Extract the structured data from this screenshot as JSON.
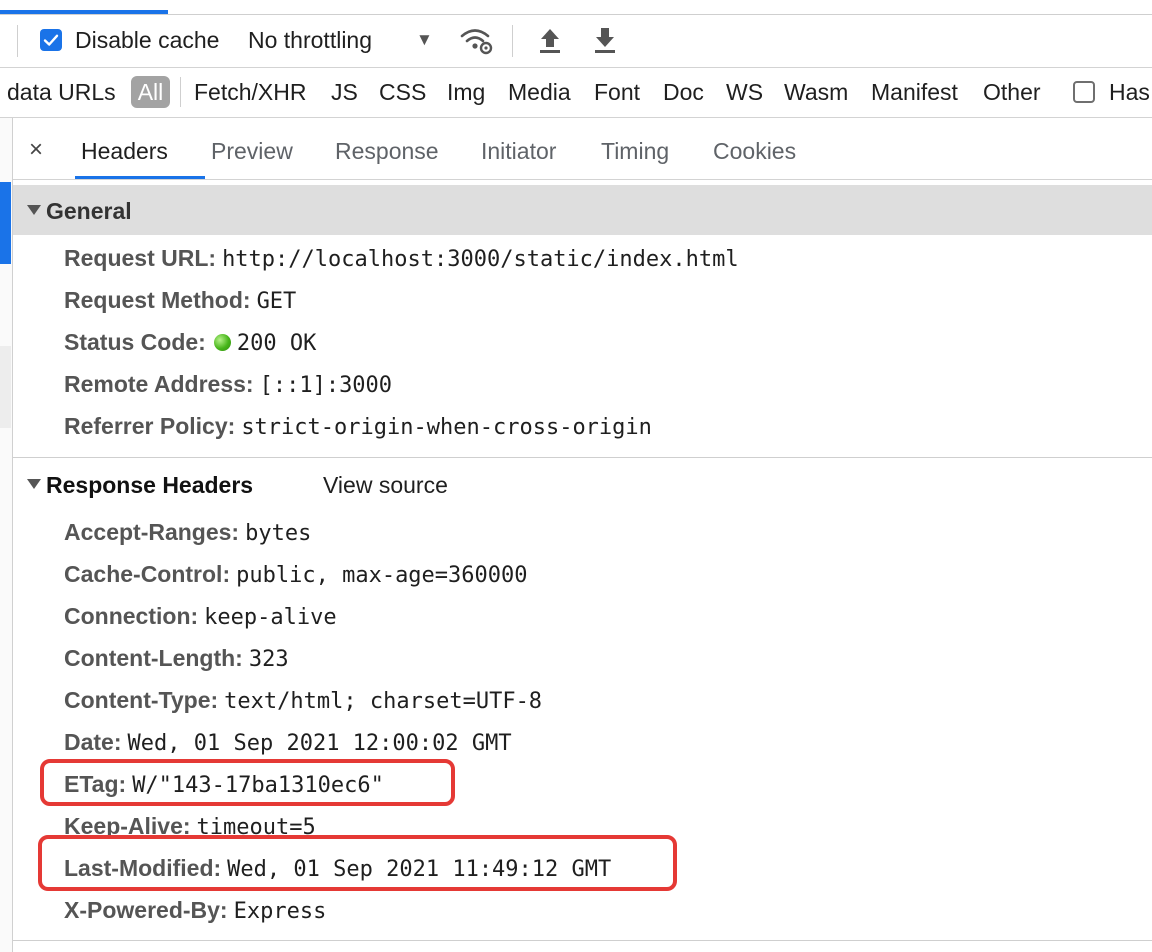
{
  "toolbar": {
    "disable_cache_label": "Disable cache",
    "disable_cache_checked": true,
    "throttling_value": "No throttling",
    "throttling_arrow": "▼"
  },
  "filters": {
    "items": [
      "data URLs",
      "All",
      "Fetch/XHR",
      "JS",
      "CSS",
      "Img",
      "Media",
      "Font",
      "Doc",
      "WS",
      "Wasm",
      "Manifest",
      "Other"
    ],
    "trailing_checkbox_label": "Has"
  },
  "tabs": {
    "close": "×",
    "items": [
      "Headers",
      "Preview",
      "Response",
      "Initiator",
      "Timing",
      "Cookies"
    ],
    "active": "Headers"
  },
  "general": {
    "title": "General",
    "rows": [
      {
        "key": "Request URL:",
        "value": "http://localhost:3000/static/index.html"
      },
      {
        "key": "Request Method:",
        "value": "GET"
      },
      {
        "key": "Status Code:",
        "value": "200 OK"
      },
      {
        "key": "Remote Address:",
        "value": "[::1]:3000"
      },
      {
        "key": "Referrer Policy:",
        "value": "strict-origin-when-cross-origin"
      }
    ]
  },
  "response_headers": {
    "title": "Response Headers",
    "view_source": "View source",
    "rows": [
      {
        "key": "Accept-Ranges:",
        "value": "bytes"
      },
      {
        "key": "Cache-Control:",
        "value": "public, max-age=360000"
      },
      {
        "key": "Connection:",
        "value": "keep-alive"
      },
      {
        "key": "Content-Length:",
        "value": "323"
      },
      {
        "key": "Content-Type:",
        "value": "text/html; charset=UTF-8"
      },
      {
        "key": "Date:",
        "value": "Wed, 01 Sep 2021 12:00:02 GMT"
      },
      {
        "key": "ETag:",
        "value": "W/\"143-17ba1310ec6\""
      },
      {
        "key": "Keep-Alive:",
        "value": "timeout=5"
      },
      {
        "key": "Last-Modified:",
        "value": "Wed, 01 Sep 2021 11:49:12 GMT"
      },
      {
        "key": "X-Powered-By:",
        "value": "Express"
      }
    ]
  },
  "colors": {
    "accent": "#1a73e8",
    "highlight": "#e53935",
    "status_ok": "#47b51a"
  }
}
